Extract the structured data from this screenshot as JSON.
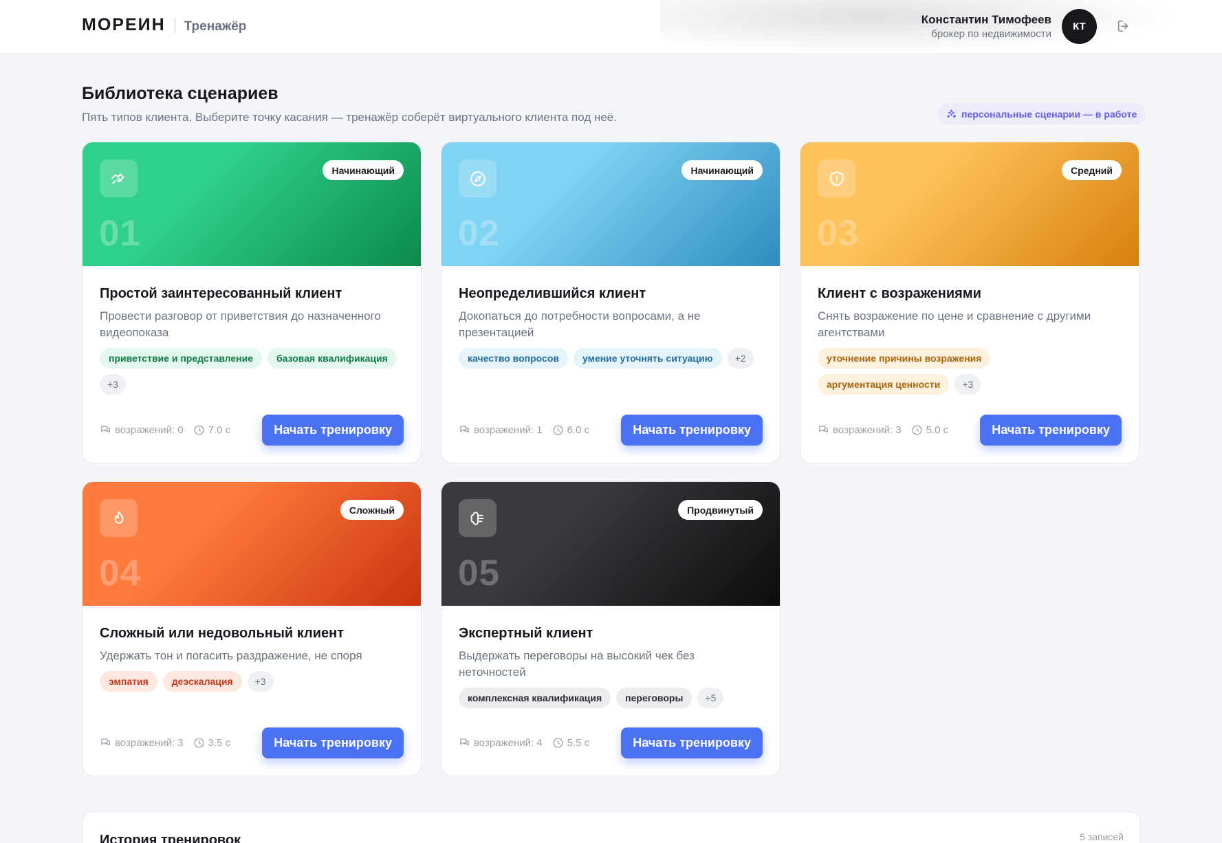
{
  "header": {
    "logo": "МОРЕИН",
    "product": "Тренажёр",
    "user_name": "Константин Тимофеев",
    "user_role": "брокер по недвижимости",
    "avatar_initials": "КТ"
  },
  "library": {
    "title": "Библиотека сценариев",
    "subtitle": "Пять типов клиента. Выберите точку касания — тренажёр соберёт виртуального клиента под неё.",
    "badge": "персональные сценарии — в работе"
  },
  "start_label": "Начать тренировку",
  "objections_prefix": "возражений:",
  "cards": [
    {
      "num": "01",
      "level": "Начинающий",
      "icon": "handshake-icon",
      "title": "Простой заинтересованный клиент",
      "desc": "Провести разговор от приветствия до назначенного видеопоказа",
      "tags": [
        "приветствие и представление",
        "базовая квалификация"
      ],
      "more": "+3",
      "objections": "возражений: 0",
      "time": "7.0 с",
      "gradient": [
        "#2fd08a",
        "#0b8a4a"
      ],
      "tag_bg": "#e4f7ee",
      "tag_fg": "#0f7a45"
    },
    {
      "num": "02",
      "level": "Начинающий",
      "icon": "compass-icon",
      "title": "Неопределившийся клиент",
      "desc": "Докопаться до потребности вопросами, а не презентацией",
      "tags": [
        "качество вопросов",
        "умение уточнять ситуацию"
      ],
      "more": "+2",
      "objections": "возражений: 1",
      "time": "6.0 с",
      "gradient": [
        "#7fd3f3",
        "#2f8cbf"
      ],
      "tag_bg": "#e5f3fb",
      "tag_fg": "#1f6e9e"
    },
    {
      "num": "03",
      "level": "Средний",
      "icon": "shield-alert-icon",
      "title": "Клиент с возражениями",
      "desc": "Снять возражение по цене и сравнение с другими агентствами",
      "tags": [
        "уточнение причины возражения",
        "аргументация ценности"
      ],
      "more": "+3",
      "objections": "возражений: 3",
      "time": "5.0 с",
      "gradient": [
        "#ffc15a",
        "#d6800c"
      ],
      "tag_bg": "#fdf1dd",
      "tag_fg": "#a8650a"
    },
    {
      "num": "04",
      "level": "Сложный",
      "icon": "flame-icon",
      "title": "Сложный или недовольный клиент",
      "desc": "Удержать тон и погасить раздражение, не споря",
      "tags": [
        "эмпатия",
        "деэскалация"
      ],
      "more": "+3",
      "objections": "возражений: 3",
      "time": "3.5 с",
      "gradient": [
        "#ff7a3d",
        "#c9340e"
      ],
      "tag_bg": "#fde7df",
      "tag_fg": "#c5391b"
    },
    {
      "num": "05",
      "level": "Продвинутый",
      "icon": "brain-icon",
      "title": "Экспертный клиент",
      "desc": "Выдержать переговоры на высокий чек без неточностей",
      "tags": [
        "комплексная квалификация",
        "переговоры"
      ],
      "more": "+5",
      "objections": "возражений: 4",
      "time": "5.5 с",
      "gradient": [
        "#3a3a3e",
        "#0c0c0e"
      ],
      "tag_bg": "#ececee",
      "tag_fg": "#2a2b30"
    }
  ],
  "history": {
    "title": "История тренировок",
    "count": "5 записей"
  }
}
